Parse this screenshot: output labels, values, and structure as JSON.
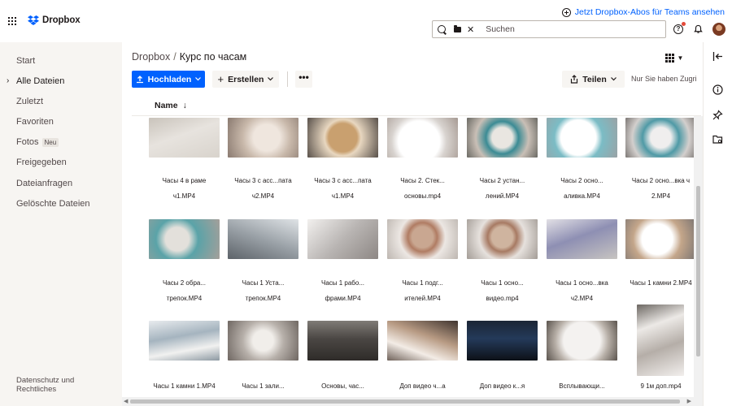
{
  "brand": {
    "name": "Dropbox"
  },
  "topbar": {
    "teams_link": "Jetzt Dropbox-Abos für Teams ansehen",
    "search_placeholder": "Suchen"
  },
  "sidebar": {
    "items": [
      {
        "label": "Start"
      },
      {
        "label": "Alle Dateien",
        "active": true
      },
      {
        "label": "Zuletzt"
      },
      {
        "label": "Favoriten"
      },
      {
        "label": "Fotos",
        "badge": "Neu"
      },
      {
        "label": "Freigegeben"
      },
      {
        "label": "Dateianfragen"
      },
      {
        "label": "Gelöschte Dateien"
      }
    ],
    "footer": "Datenschutz und Rechtliches"
  },
  "breadcrumb": {
    "root": "Dropbox",
    "separator": "/",
    "current": "Курс по часам"
  },
  "toolbar": {
    "upload_label": "Hochladen",
    "create_label": "Erstellen",
    "more_label": "•••",
    "share_label": "Teilen",
    "access_note": "Nur Sie haben Zugriff"
  },
  "list": {
    "column": "Name",
    "sort": "descending"
  },
  "files": [
    {
      "line1": "Часы 4 в раме",
      "line2": "ч1.MP4"
    },
    {
      "line1": "Часы 3 с асс...пата",
      "line2": "ч2.MP4"
    },
    {
      "line1": "Часы 3 с асс...пата",
      "line2": "ч1.MP4"
    },
    {
      "line1": "Часы 2. Стек...",
      "line2": "основы.mp4"
    },
    {
      "line1": "Часы 2 устан...",
      "line2": "лений.MP4"
    },
    {
      "line1": "Часы 2 осно...",
      "line2": "аливка.MP4"
    },
    {
      "line1": "Часы 2 осно...вка ч",
      "line2": "2.MP4"
    },
    {
      "line1": "Часы 2 обра...",
      "line2": "трепок.MP4"
    },
    {
      "line1": "Часы 1 Уста...",
      "line2": "трепок.MP4"
    },
    {
      "line1": "Часы 1 рабо...",
      "line2": "фрами.MP4"
    },
    {
      "line1": "Часы 1 подг...",
      "line2": "ителей.MP4"
    },
    {
      "line1": "Часы 1 осно...",
      "line2": "видео.mp4"
    },
    {
      "line1": "Часы 1 осно...вка",
      "line2": "ч2.MP4"
    },
    {
      "line1": "Часы 1 камни 2.MP4",
      "line2": ""
    },
    {
      "line1": "Часы 1 камни 1.MP4",
      "line2": ""
    },
    {
      "line1": "Часы 1 зали...",
      "line2": ""
    },
    {
      "line1": "Основы, час...",
      "line2": ""
    },
    {
      "line1": "Доп видео ч...а",
      "line2": ""
    },
    {
      "line1": "Доп видео к...я",
      "line2": ""
    },
    {
      "line1": "Всплывающи...",
      "line2": ""
    },
    {
      "line1": "9 1м доп.mp4",
      "line2": ""
    }
  ],
  "colors": {
    "accent": "#0061fe",
    "sidebar_bg": "#f7f5f2",
    "notification": "#e34a3a"
  },
  "icons": {
    "rail": [
      "collapse-panel-icon",
      "info-icon",
      "pin-icon",
      "folder-settings-icon"
    ]
  }
}
